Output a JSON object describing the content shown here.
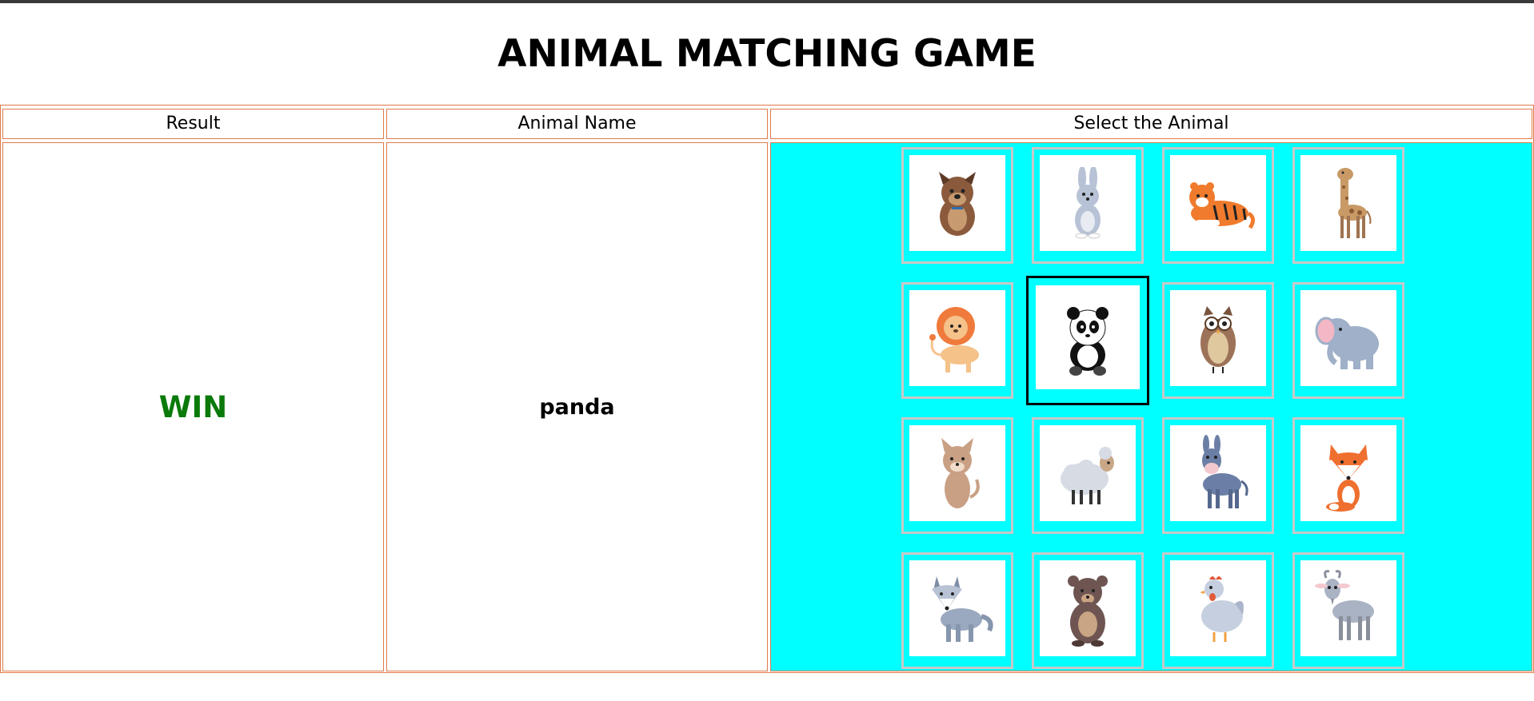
{
  "page": {
    "title": "ANIMAL MATCHING GAME"
  },
  "table": {
    "headers": [
      "Result",
      "Animal Name",
      "Select the Animal"
    ],
    "result": "WIN",
    "animal_name": "panda"
  },
  "colors": {
    "result_win": "#0a7a0a",
    "grid_background": "#00ffff",
    "border": "#e07a4a"
  },
  "animals": [
    {
      "name": "dog",
      "icon": "dog-icon",
      "selected": false
    },
    {
      "name": "rabbit",
      "icon": "rabbit-icon",
      "selected": false
    },
    {
      "name": "tiger",
      "icon": "tiger-icon",
      "selected": false
    },
    {
      "name": "giraffe",
      "icon": "giraffe-icon",
      "selected": false
    },
    {
      "name": "lion",
      "icon": "lion-icon",
      "selected": false
    },
    {
      "name": "panda",
      "icon": "panda-icon",
      "selected": true
    },
    {
      "name": "owl",
      "icon": "owl-icon",
      "selected": false
    },
    {
      "name": "elephant",
      "icon": "elephant-icon",
      "selected": false
    },
    {
      "name": "cat",
      "icon": "cat-icon",
      "selected": false
    },
    {
      "name": "sheep",
      "icon": "sheep-icon",
      "selected": false
    },
    {
      "name": "donkey",
      "icon": "donkey-icon",
      "selected": false
    },
    {
      "name": "fox",
      "icon": "fox-icon",
      "selected": false
    },
    {
      "name": "wolf",
      "icon": "wolf-icon",
      "selected": false
    },
    {
      "name": "bear",
      "icon": "bear-icon",
      "selected": false
    },
    {
      "name": "chicken",
      "icon": "chicken-icon",
      "selected": false
    },
    {
      "name": "goat",
      "icon": "goat-icon",
      "selected": false
    }
  ]
}
